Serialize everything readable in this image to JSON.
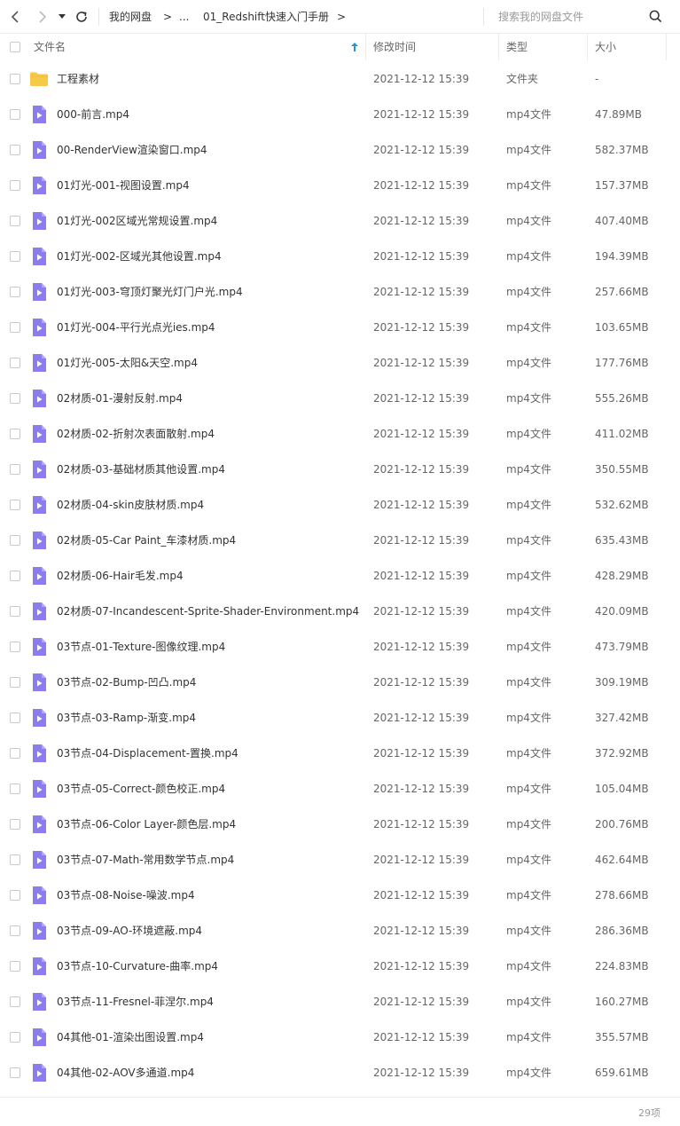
{
  "breadcrumb": {
    "root": "我的网盘",
    "ellipsis": "...",
    "current": "01_Redshift快速入门手册",
    "arrow": ">"
  },
  "search": {
    "placeholder": "搜索我的网盘文件"
  },
  "columns": {
    "name": "文件名",
    "modified": "修改时间",
    "type": "类型",
    "size": "大小"
  },
  "colors": {
    "folder": "#f7c948",
    "video": "#8b7cf0",
    "sort_accent": "#1a9bd7"
  },
  "files": [
    {
      "name": "工程素材",
      "date": "2021-12-12 15:39",
      "type": "文件夹",
      "size": "-",
      "icon": "folder-icon"
    },
    {
      "name": "000-前言.mp4",
      "date": "2021-12-12 15:39",
      "type": "mp4文件",
      "size": "47.89MB",
      "icon": "video-file-icon"
    },
    {
      "name": "00-RenderView渲染窗口.mp4",
      "date": "2021-12-12 15:39",
      "type": "mp4文件",
      "size": "582.37MB",
      "icon": "video-file-icon"
    },
    {
      "name": "01灯光-001-视图设置.mp4",
      "date": "2021-12-12 15:39",
      "type": "mp4文件",
      "size": "157.37MB",
      "icon": "video-file-icon"
    },
    {
      "name": "01灯光-002区域光常规设置.mp4",
      "date": "2021-12-12 15:39",
      "type": "mp4文件",
      "size": "407.40MB",
      "icon": "video-file-icon"
    },
    {
      "name": "01灯光-002-区域光其他设置.mp4",
      "date": "2021-12-12 15:39",
      "type": "mp4文件",
      "size": "194.39MB",
      "icon": "video-file-icon"
    },
    {
      "name": "01灯光-003-穹顶灯聚光灯门户光.mp4",
      "date": "2021-12-12 15:39",
      "type": "mp4文件",
      "size": "257.66MB",
      "icon": "video-file-icon"
    },
    {
      "name": "01灯光-004-平行光点光ies.mp4",
      "date": "2021-12-12 15:39",
      "type": "mp4文件",
      "size": "103.65MB",
      "icon": "video-file-icon"
    },
    {
      "name": "01灯光-005-太阳&天空.mp4",
      "date": "2021-12-12 15:39",
      "type": "mp4文件",
      "size": "177.76MB",
      "icon": "video-file-icon"
    },
    {
      "name": "02材质-01-漫射反射.mp4",
      "date": "2021-12-12 15:39",
      "type": "mp4文件",
      "size": "555.26MB",
      "icon": "video-file-icon"
    },
    {
      "name": "02材质-02-折射次表面散射.mp4",
      "date": "2021-12-12 15:39",
      "type": "mp4文件",
      "size": "411.02MB",
      "icon": "video-file-icon"
    },
    {
      "name": "02材质-03-基础材质其他设置.mp4",
      "date": "2021-12-12 15:39",
      "type": "mp4文件",
      "size": "350.55MB",
      "icon": "video-file-icon"
    },
    {
      "name": "02材质-04-skin皮肤材质.mp4",
      "date": "2021-12-12 15:39",
      "type": "mp4文件",
      "size": "532.62MB",
      "icon": "video-file-icon"
    },
    {
      "name": "02材质-05-Car Paint_车漆材质.mp4",
      "date": "2021-12-12 15:39",
      "type": "mp4文件",
      "size": "635.43MB",
      "icon": "video-file-icon"
    },
    {
      "name": "02材质-06-Hair毛发.mp4",
      "date": "2021-12-12 15:39",
      "type": "mp4文件",
      "size": "428.29MB",
      "icon": "video-file-icon"
    },
    {
      "name": "02材质-07-Incandescent-Sprite-Shader-Environment.mp4",
      "date": "2021-12-12 15:39",
      "type": "mp4文件",
      "size": "420.09MB",
      "icon": "video-file-icon"
    },
    {
      "name": "03节点-01-Texture-图像纹理.mp4",
      "date": "2021-12-12 15:39",
      "type": "mp4文件",
      "size": "473.79MB",
      "icon": "video-file-icon"
    },
    {
      "name": "03节点-02-Bump-凹凸.mp4",
      "date": "2021-12-12 15:39",
      "type": "mp4文件",
      "size": "309.19MB",
      "icon": "video-file-icon"
    },
    {
      "name": "03节点-03-Ramp-渐变.mp4",
      "date": "2021-12-12 15:39",
      "type": "mp4文件",
      "size": "327.42MB",
      "icon": "video-file-icon"
    },
    {
      "name": "03节点-04-Displacement-置换.mp4",
      "date": "2021-12-12 15:39",
      "type": "mp4文件",
      "size": "372.92MB",
      "icon": "video-file-icon"
    },
    {
      "name": "03节点-05-Correct-颜色校正.mp4",
      "date": "2021-12-12 15:39",
      "type": "mp4文件",
      "size": "105.04MB",
      "icon": "video-file-icon"
    },
    {
      "name": "03节点-06-Color Layer-颜色层.mp4",
      "date": "2021-12-12 15:39",
      "type": "mp4文件",
      "size": "200.76MB",
      "icon": "video-file-icon"
    },
    {
      "name": "03节点-07-Math-常用数学节点.mp4",
      "date": "2021-12-12 15:39",
      "type": "mp4文件",
      "size": "462.64MB",
      "icon": "video-file-icon"
    },
    {
      "name": "03节点-08-Noise-噪波.mp4",
      "date": "2021-12-12 15:39",
      "type": "mp4文件",
      "size": "278.66MB",
      "icon": "video-file-icon"
    },
    {
      "name": "03节点-09-AO-环境遮蔽.mp4",
      "date": "2021-12-12 15:39",
      "type": "mp4文件",
      "size": "286.36MB",
      "icon": "video-file-icon"
    },
    {
      "name": "03节点-10-Curvature-曲率.mp4",
      "date": "2021-12-12 15:39",
      "type": "mp4文件",
      "size": "224.83MB",
      "icon": "video-file-icon"
    },
    {
      "name": "03节点-11-Fresnel-菲涅尔.mp4",
      "date": "2021-12-12 15:39",
      "type": "mp4文件",
      "size": "160.27MB",
      "icon": "video-file-icon"
    },
    {
      "name": "04其他-01-渲染出图设置.mp4",
      "date": "2021-12-12 15:39",
      "type": "mp4文件",
      "size": "355.57MB",
      "icon": "video-file-icon"
    },
    {
      "name": "04其他-02-AOV多通道.mp4",
      "date": "2021-12-12 15:39",
      "type": "mp4文件",
      "size": "659.61MB",
      "icon": "video-file-icon"
    }
  ],
  "footer": {
    "count": "29项"
  }
}
